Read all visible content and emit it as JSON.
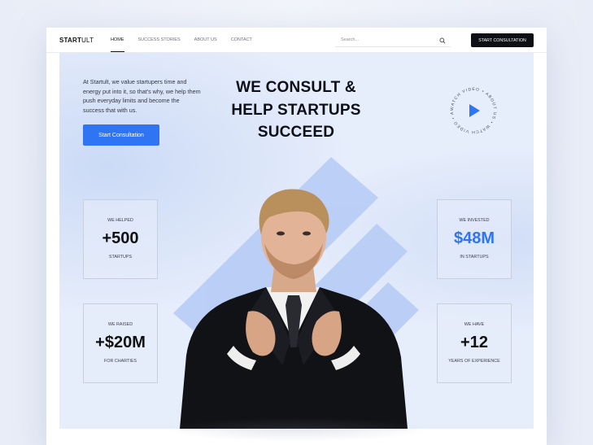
{
  "brand": {
    "logo_bold": "START",
    "logo_light": "ULT"
  },
  "nav": {
    "items": [
      {
        "label": "HOME",
        "active": true
      },
      {
        "label": "SUCCESS STORIES",
        "active": false
      },
      {
        "label": "ABOUT US",
        "active": false
      },
      {
        "label": "CONTACT",
        "active": false
      }
    ],
    "search_placeholder": "Search...",
    "cta_label": "START CONSULTATION"
  },
  "hero": {
    "intro": "At Startult, we value startupers time and energy put into it, so that's why, we help them push everyday limits and become the success that with us.",
    "cta_label": "Start Consultation",
    "headline_lines": [
      "WE CONSULT &",
      "HELP STARTUPS",
      "SUCCEED"
    ],
    "video_ring_text": "WATCH VIDEO • ABOUT US • WATCH VIDEO • ABOUT US •"
  },
  "stats": [
    {
      "label": "WE HELPED",
      "value": "+500",
      "sub": "STARTUPS",
      "accent": false
    },
    {
      "label": "WE INVESTED",
      "value": "$48M",
      "sub": "IN STARTUPS",
      "accent": true
    },
    {
      "label": "WE RAISED",
      "value": "+$20M",
      "sub": "FOR CHARTIES",
      "accent": false
    },
    {
      "label": "WE HAVE",
      "value": "+12",
      "sub": "YEARS OF EXPERIENCE",
      "accent": false
    }
  ],
  "colors": {
    "accent": "#2f74f3",
    "dark": "#0e0f14",
    "hero_bg": "#e6edfb",
    "shape": "#b9cdf6"
  },
  "icons": {
    "search": "search-icon",
    "play": "play-icon"
  }
}
